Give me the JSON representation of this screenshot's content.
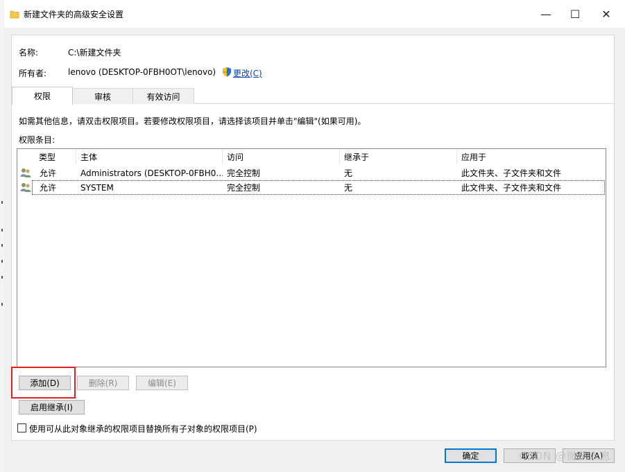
{
  "window": {
    "title": "新建文件夹的高级安全设置",
    "minimize_glyph": "—",
    "maximize_glyph": "☐",
    "close_glyph": "✕"
  },
  "info": {
    "name_label": "名称:",
    "name_value": "C:\\新建文件夹",
    "owner_label": "所有者:",
    "owner_value": "lenovo (DESKTOP-0FBH0OT\\lenovo)",
    "change_link": "更改(C)"
  },
  "tabs": [
    {
      "label": "权限"
    },
    {
      "label": "审核"
    },
    {
      "label": "有效访问"
    }
  ],
  "hint_text": "如需其他信息，请双击权限项目。若要修改权限项目，请选择该项目并单击\"编辑\"(如果可用)。",
  "list_label": "权限条目:",
  "table": {
    "headers": [
      "类型",
      "主体",
      "访问",
      "继承于",
      "应用于"
    ],
    "rows": [
      {
        "type": "允许",
        "principal": "Administrators (DESKTOP-0FBH0...",
        "access": "完全控制",
        "inherited": "无",
        "applies": "此文件夹、子文件夹和文件"
      },
      {
        "type": "允许",
        "principal": "SYSTEM",
        "access": "完全控制",
        "inherited": "无",
        "applies": "此文件夹、子文件夹和文件"
      }
    ]
  },
  "buttons": {
    "add": "添加(D)",
    "remove": "删除(R)",
    "edit": "编辑(E)",
    "enable_inheritance": "启用继承(I)",
    "ok": "确定",
    "cancel": "取消",
    "apply": "应用(A)"
  },
  "checkbox_label": "使用可从此对象继承的权限项目替换所有子对象的权限项目(P)",
  "watermark": "CSDN @微风人息",
  "colors": {
    "highlight_box": "#e02020",
    "link": "#0645ad",
    "default_button_border": "#0078d7"
  }
}
